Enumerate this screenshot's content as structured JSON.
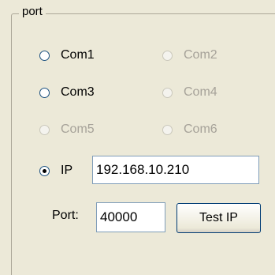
{
  "group": {
    "title": "port"
  },
  "radios": [
    {
      "label": "Com1",
      "enabled": true,
      "checked": false
    },
    {
      "label": "Com2",
      "enabled": false,
      "checked": false
    },
    {
      "label": "Com3",
      "enabled": true,
      "checked": false
    },
    {
      "label": "Com4",
      "enabled": false,
      "checked": false
    },
    {
      "label": "Com5",
      "enabled": false,
      "checked": false
    },
    {
      "label": "Com6",
      "enabled": false,
      "checked": false
    },
    {
      "label": "IP",
      "enabled": true,
      "checked": true
    }
  ],
  "ip_field": {
    "value": "192.168.10.210"
  },
  "port_field": {
    "label": "Port:",
    "value": "40000"
  },
  "test_button": {
    "label": "Test IP"
  }
}
